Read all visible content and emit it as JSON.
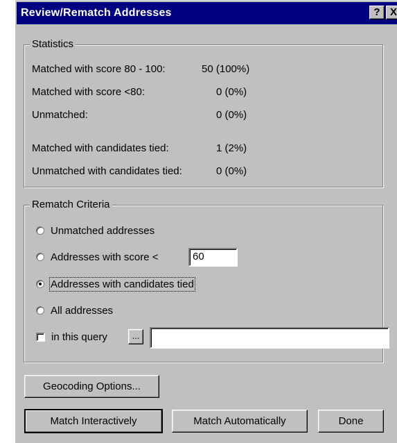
{
  "window": {
    "title": "Review/Rematch Addresses"
  },
  "titlebar": {
    "help_glyph": "?",
    "close_glyph": "X"
  },
  "statistics": {
    "legend": "Statistics",
    "rows": [
      {
        "label": "Matched with score 80 - 100:",
        "value": "50  (100%)"
      },
      {
        "label": "Matched with score <80:",
        "value": "0  (0%)"
      },
      {
        "label": "Unmatched:",
        "value": "0  (0%)"
      },
      {
        "label": "Matched with candidates tied:",
        "value": "1  (2%)"
      },
      {
        "label": "Unmatched with candidates tied:",
        "value": "0  (0%)"
      }
    ]
  },
  "criteria": {
    "legend": "Rematch Criteria",
    "options": [
      {
        "label": "Unmatched addresses",
        "checked": false
      },
      {
        "label": "Addresses with score <",
        "checked": false
      },
      {
        "label": "Addresses with candidates tied",
        "checked": true
      },
      {
        "label": "All addresses",
        "checked": false
      }
    ],
    "score_value": "60",
    "query_label": "in this query",
    "query_browse_label": "...",
    "query_value": ""
  },
  "buttons": {
    "geocoding_options": "Geocoding Options...",
    "match_interactively": "Match Interactively",
    "match_automatically": "Match Automatically",
    "done": "Done"
  }
}
